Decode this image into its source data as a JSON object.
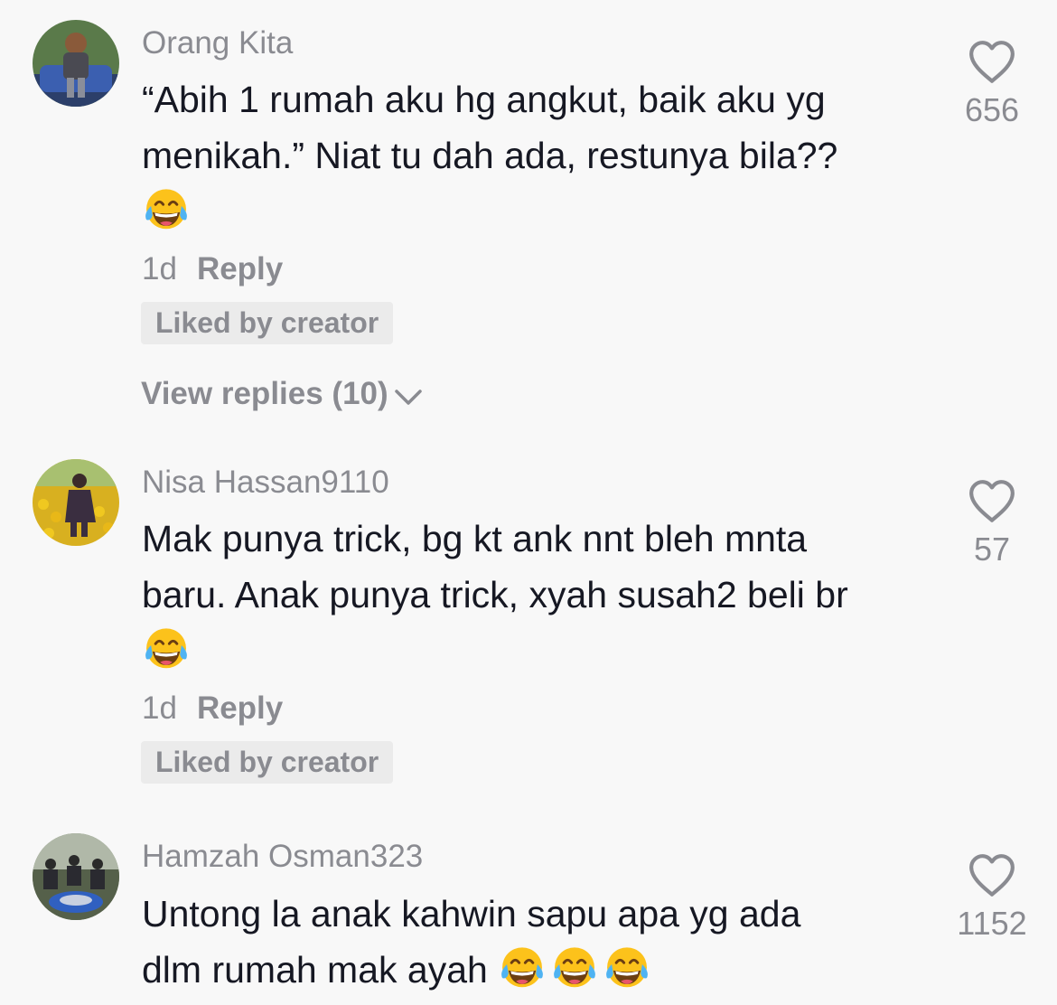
{
  "comments": [
    {
      "username": "Orang Kita",
      "text_line1": "“Abih 1 rumah aku hg angkut, baik aku yg",
      "text_line2": "menikah.” Niat tu dah ada, restunya bila??",
      "emoji_count": 1,
      "emoji_icon": "face-with-tears-of-joy-icon",
      "time": "1d",
      "reply_label": "Reply",
      "liked_label": "Liked by creator",
      "view_replies_label": "View replies (10)",
      "likes": "656"
    },
    {
      "username": "Nisa Hassan9110",
      "text_line1": "Mak punya trick, bg kt ank nnt bleh mnta",
      "text_line2": "baru. Anak punya trick, xyah susah2 beli br",
      "emoji_count": 1,
      "emoji_icon": "face-with-tears-of-joy-icon",
      "time": "1d",
      "reply_label": "Reply",
      "liked_label": "Liked by creator",
      "likes": "57"
    },
    {
      "username": "Hamzah Osman323",
      "text_line1": "Untong la anak kahwin sapu apa yg ada",
      "text_line2": "dlm rumah mak ayah",
      "emoji_count": 3,
      "emoji_icon": "face-with-tears-of-joy-icon",
      "likes": "1152"
    }
  ],
  "colors": {
    "background": "#f8f8f8",
    "primary_text": "#161823",
    "secondary_text": "#8a8b91",
    "badge_bg": "#ebebeb",
    "emoji_yellow": "#fcc21b"
  }
}
